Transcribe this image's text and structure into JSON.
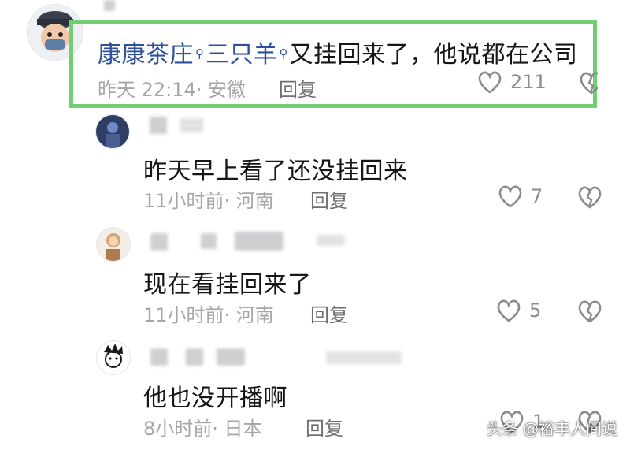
{
  "top_comment": {
    "author": "康康茶庄",
    "mention": "三只羊",
    "text": "又挂回来了，他说都在公司",
    "time": "昨天 22:14",
    "location": "· 安徽",
    "reply_label": "回复",
    "like_count": "211",
    "icons": {
      "search": "search-icon",
      "like": "heart-outline-icon",
      "dislike": "broken-heart-icon"
    }
  },
  "replies": [
    {
      "text": "昨天早上看了还没挂回来",
      "time": "11小时前",
      "location": "· 河南",
      "reply_label": "回复",
      "like_count": "7"
    },
    {
      "text": "现在看挂回来了",
      "time": "11小时前",
      "location": "· 河南",
      "reply_label": "回复",
      "like_count": "5"
    },
    {
      "text": "他也没开播啊",
      "time": "8小时前",
      "location": "· 日本",
      "reply_label": "回复",
      "like_count": "1"
    }
  ],
  "watermark": "头条 @裕丰人间说",
  "colors": {
    "highlight_border": "#74cc73",
    "author_link": "#2d4f9c",
    "meta": "#a6a6a8"
  }
}
